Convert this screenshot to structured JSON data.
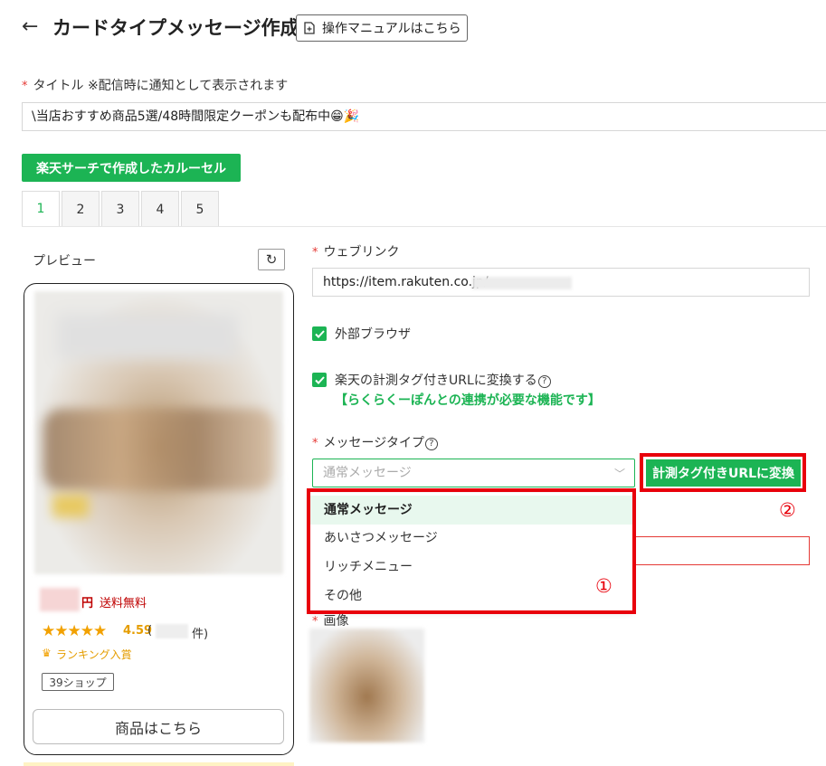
{
  "header": {
    "back_icon": "←",
    "title": "カードタイプメッセージ作成",
    "manual_button": "操作マニュアルはこちら"
  },
  "title_field": {
    "label": "タイトル ※配信時に通知として表示されます",
    "value": "\\当店おすすめ商品5選/48時間限定クーポンも配布中😁🎉"
  },
  "carousel_button": "楽天サーチで作成したカルーセル",
  "tabs": [
    "1",
    "2",
    "3",
    "4",
    "5"
  ],
  "active_tab": "1",
  "preview": {
    "label": "プレビュー",
    "refresh_icon": "↻",
    "price_unit": "円",
    "shipping": "送料無料",
    "stars_icon": "★★★★★",
    "rating": "4.59",
    "rating_open": "(",
    "rating_close": "件)",
    "ranking_icon": "♛",
    "ranking": "ランキング入賞",
    "shop_badge": "39ショップ",
    "product_button": "商品はこちら"
  },
  "form": {
    "web_link_label": "ウェブリンク",
    "web_link_value": "https://item.rakuten.co.jp/",
    "external_browser": "外部ブラウザ",
    "tag_url_convert_label": "楽天の計測タグ付きURLに変換する",
    "help_icon": "?",
    "tag_note": "【らくらくーぽんとの連携が必要な機能です】",
    "message_type_label": "メッセージタイプ",
    "message_type_placeholder": "通常メッセージ",
    "chevron": "﹀",
    "convert_button": "計測タグ付きURLに変換",
    "image_label": "画像",
    "required_mark": "*"
  },
  "dropdown_options": [
    "通常メッセージ",
    "あいさつメッセージ",
    "リッチメニュー",
    "その他"
  ],
  "annotations": {
    "marker_1": "①",
    "marker_2": "②"
  },
  "colors": {
    "brand_green": "#1cb454",
    "annotation_red": "#e8000b",
    "price_red": "#bf0000",
    "star_orange": "#f2a100"
  }
}
